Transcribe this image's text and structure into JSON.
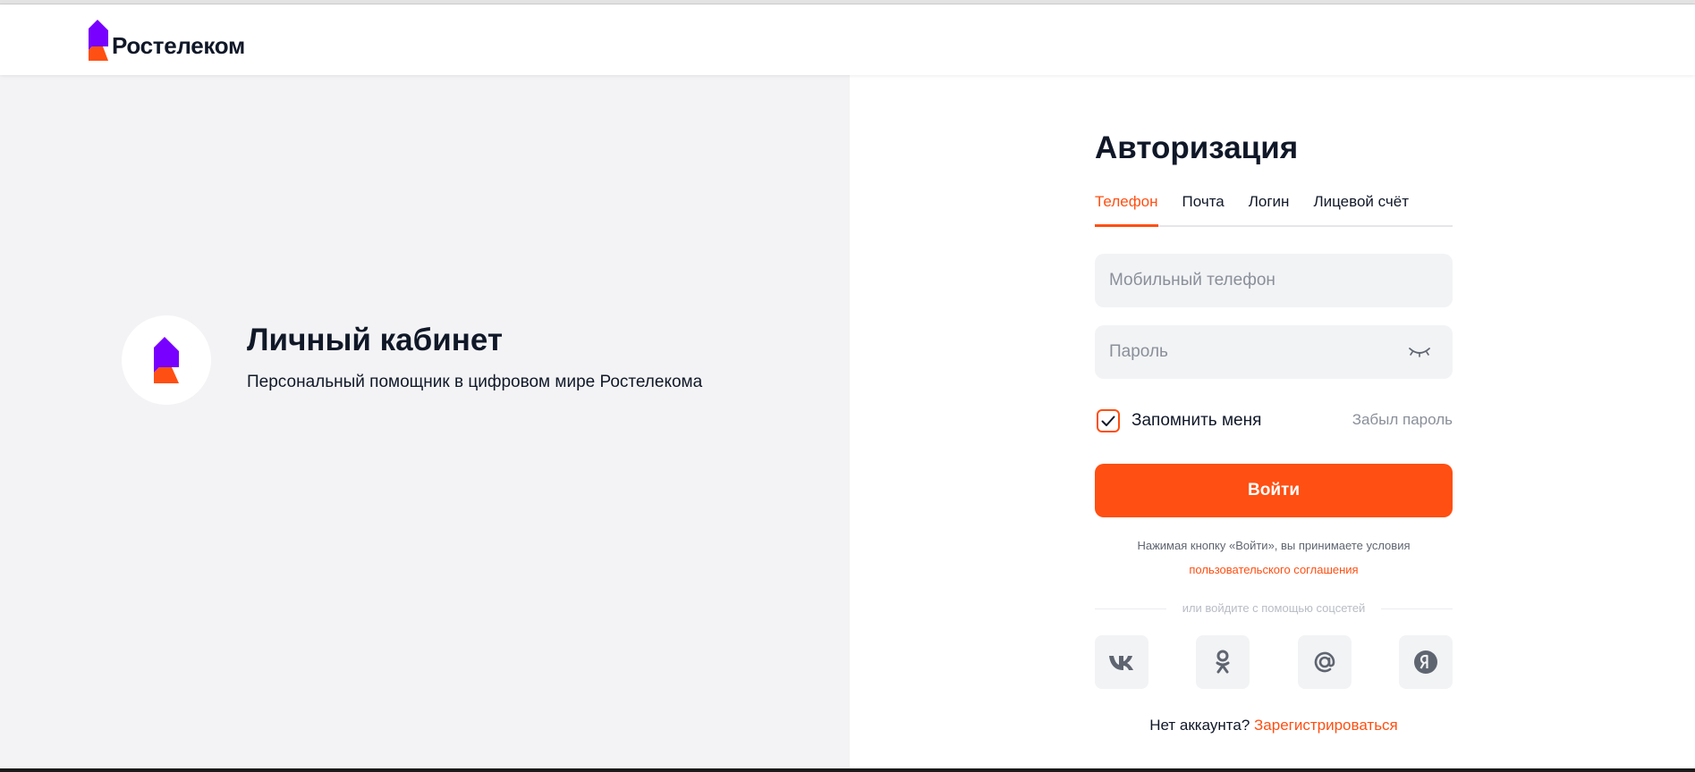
{
  "brand": {
    "name": "Ростелеком",
    "accent": "#ff4f12",
    "purple": "#7700ff"
  },
  "promo": {
    "title": "Личный кабинет",
    "subtitle": "Персональный помощник в цифровом мире Ростелекома"
  },
  "auth": {
    "title": "Авторизация",
    "tabs": [
      {
        "label": "Телефон",
        "active": true
      },
      {
        "label": "Почта",
        "active": false
      },
      {
        "label": "Логин",
        "active": false
      },
      {
        "label": "Лицевой счёт",
        "active": false
      }
    ],
    "phone_placeholder": "Мобильный телефон",
    "password_placeholder": "Пароль",
    "remember_label": "Запомнить меня",
    "remember_checked": true,
    "forgot_label": "Забыл пароль",
    "login_label": "Войти",
    "terms_text": "Нажимая кнопку «Войти», вы принимаете условия",
    "terms_link": "пользовательского соглашения",
    "social_divider": "или войдите с помощью соцсетей",
    "socials": [
      "vk-icon",
      "ok-icon",
      "mail-icon",
      "yandex-icon"
    ],
    "no_account": "Нет аккаунта?",
    "register_link": "Зарегистрироваться"
  }
}
